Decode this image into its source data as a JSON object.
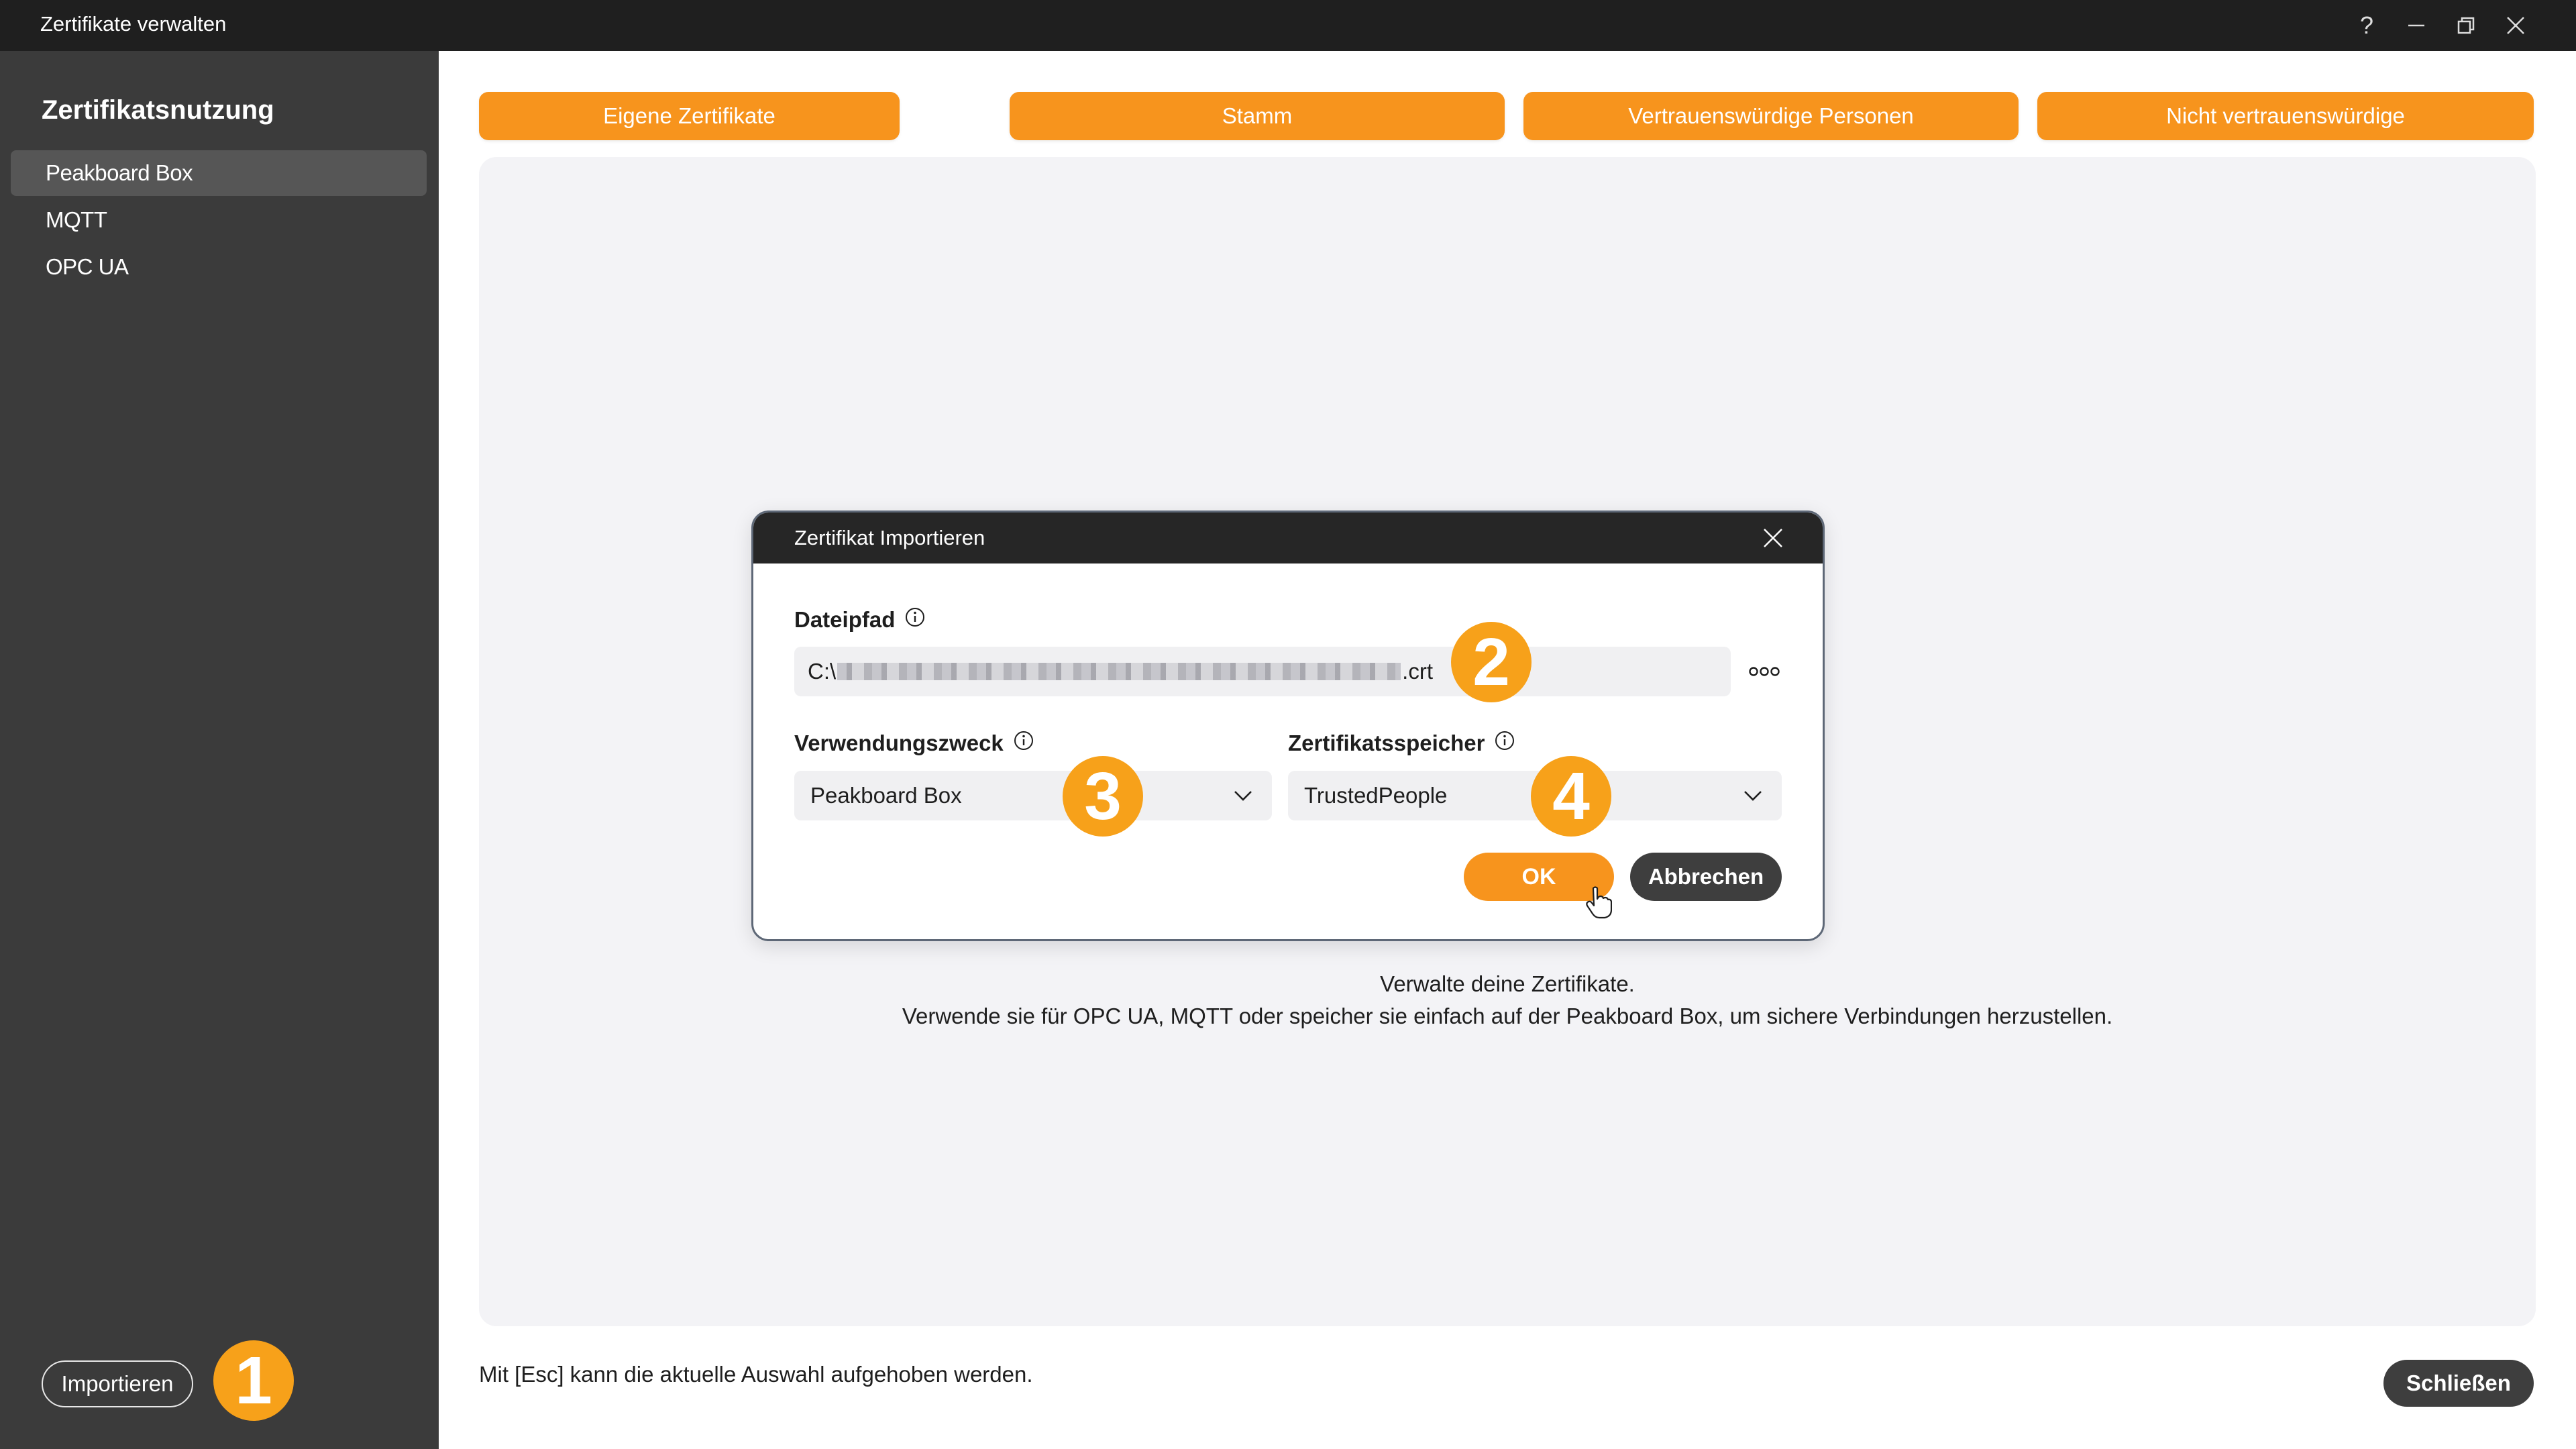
{
  "window": {
    "title": "Zertifikate verwalten",
    "controls": [
      "help-icon",
      "minimize-icon",
      "restore-icon",
      "close-icon"
    ],
    "help_glyph": "?"
  },
  "sidebar": {
    "heading": "Zertifikatsnutzung",
    "items": [
      {
        "label": "Peakboard Box",
        "active": true
      },
      {
        "label": "MQTT",
        "active": false
      },
      {
        "label": "OPC UA",
        "active": false
      }
    ],
    "import_label": "Importieren"
  },
  "tabs": [
    {
      "label": "Eigene Zertifikate"
    },
    {
      "label": "Stamm"
    },
    {
      "label": "Vertrauenswürdige Personen"
    },
    {
      "label": "Nicht vertrauenswürdige"
    }
  ],
  "main": {
    "info_line1": "Verwalte deine Zertifikate.",
    "info_line2": "Verwende sie für OPC UA, MQTT oder speicher sie einfach auf der Peakboard Box, um sichere Verbindungen herzustellen.",
    "esc_hint": "Mit [Esc] kann die aktuelle Auswahl aufgehoben werden.",
    "close_label": "Schließen"
  },
  "dialog": {
    "title": "Zertifikat Importieren",
    "file_label": "Dateipfad",
    "file_prefix": "C:\\",
    "file_suffix": ".crt",
    "browse_icon": "more-dots-icon",
    "purpose_label": "Verwendungszweck",
    "purpose_value": "Peakboard Box",
    "store_label": "Zertifikatsspeicher",
    "store_value": "TrustedPeople",
    "ok_label": "OK",
    "cancel_label": "Abbrechen"
  },
  "badges": [
    "1",
    "2",
    "3",
    "4"
  ],
  "colors": {
    "accent": "#f7941d",
    "badge": "#f7a11a",
    "sidebar": "#3b3b3b",
    "titlebar": "#1f1f1f",
    "dark_button": "#3e3e3e"
  }
}
